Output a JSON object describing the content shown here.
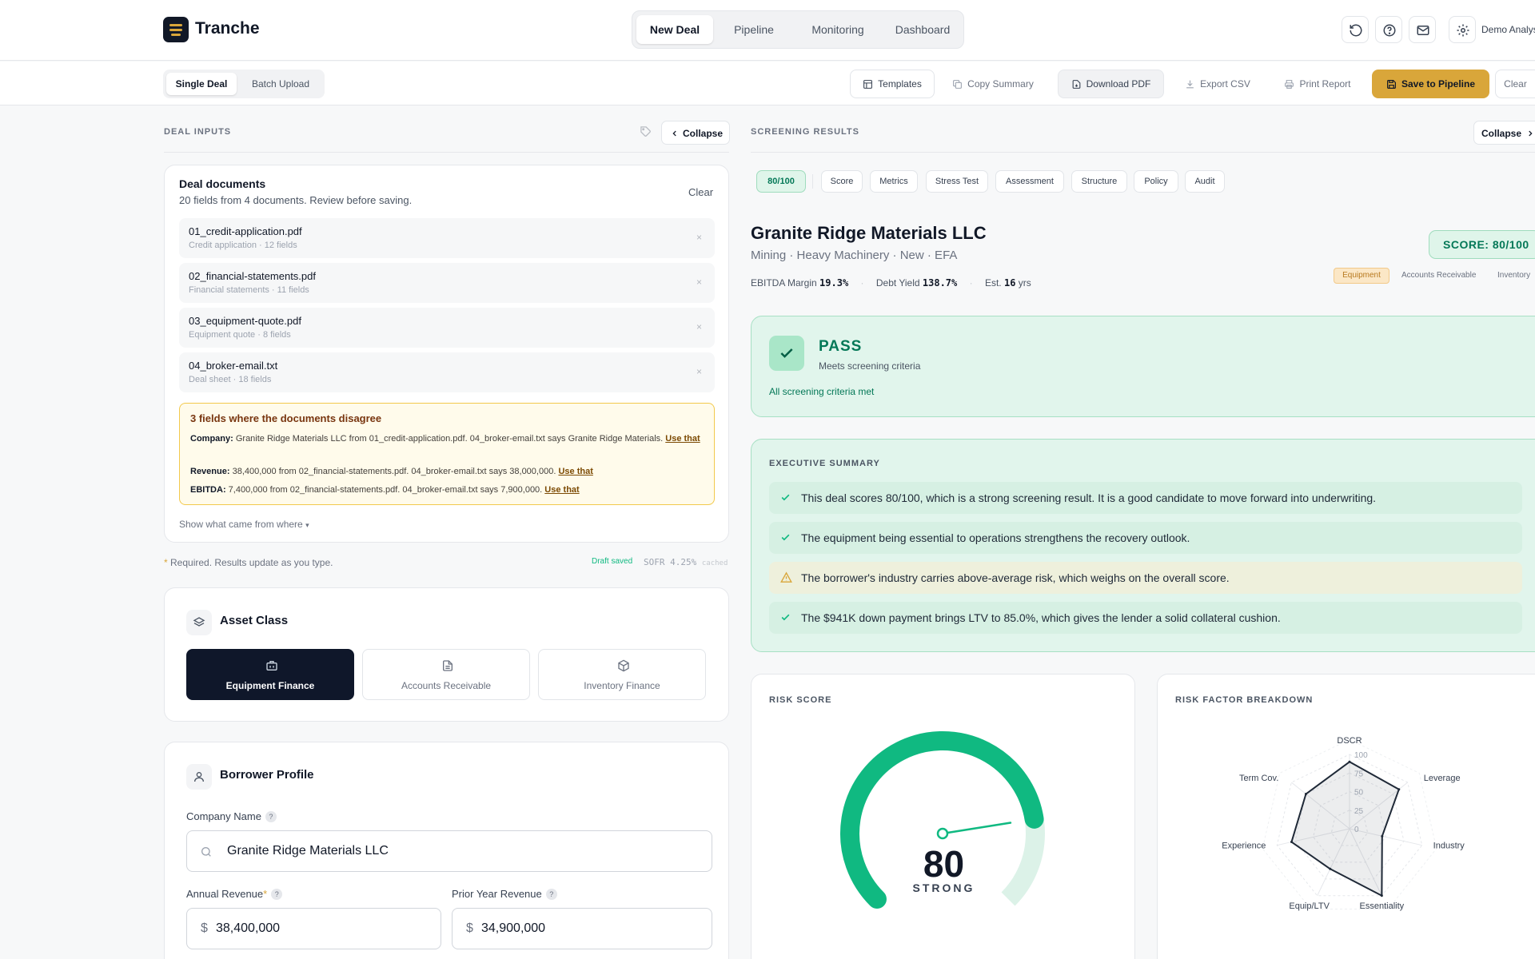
{
  "app": {
    "name": "Tranche"
  },
  "nav": {
    "tabs": [
      "New Deal",
      "Pipeline",
      "Monitoring",
      "Dashboard"
    ],
    "active": "New Deal"
  },
  "header": {
    "user_label": "Demo Analyst"
  },
  "toolbar": {
    "modes": [
      "Single Deal",
      "Batch Upload"
    ],
    "templates": "Templates",
    "copy_summary": "Copy Summary",
    "download_pdf": "Download PDF",
    "export_csv": "Export CSV",
    "print_report": "Print Report",
    "save_pipeline": "Save to Pipeline",
    "clear": "Clear"
  },
  "left": {
    "section_title": "DEAL INPUTS",
    "collapse": "Collapse",
    "docs": {
      "title": "Deal documents",
      "subtitle": "20 fields from 4 documents. Review before saving.",
      "clear": "Clear",
      "files": [
        {
          "name": "01_credit-application.pdf",
          "meta": "Credit application · 12 fields"
        },
        {
          "name": "02_financial-statements.pdf",
          "meta": "Financial statements · 11 fields"
        },
        {
          "name": "03_equipment-quote.pdf",
          "meta": "Equipment quote · 8 fields"
        },
        {
          "name": "04_broker-email.txt",
          "meta": "Deal sheet · 18 fields"
        }
      ],
      "remove_glyph": "×",
      "conflicts_title": "3 fields where the documents disagree",
      "conflicts": [
        {
          "label": "Company:",
          "text": "Granite Ridge Materials LLC from 01_credit-application.pdf. 04_broker-email.txt says Granite Ridge Materials.",
          "action": "Use that"
        },
        {
          "label": "Revenue:",
          "text": "38,400,000 from 02_financial-statements.pdf. 04_broker-email.txt says 38,000,000.",
          "action": "Use that"
        },
        {
          "label": "EBITDA:",
          "text": "7,400,000 from 02_financial-statements.pdf. 04_broker-email.txt says 7,900,000.",
          "action": "Use that"
        }
      ],
      "show_sources": "Show what came from where",
      "show_sources_caret": "▾"
    },
    "required_star": "*",
    "required_note": "Required. Results update as you type.",
    "draft_saved": "Draft saved",
    "sofr_label": "SOFR",
    "sofr_value": "4.25%",
    "sofr_cached": "cached",
    "asset_class": {
      "title": "Asset Class",
      "options": [
        "Equipment Finance",
        "Accounts Receivable",
        "Inventory Finance"
      ],
      "selected": 0
    },
    "borrower": {
      "title": "Borrower Profile",
      "company_label": "Company Name",
      "company_value": "Granite Ridge Materials LLC",
      "revenue_label": "Annual Revenue",
      "revenue_value": "38,400,000",
      "prior_label": "Prior Year Revenue",
      "prior_value": "34,900,000",
      "currency": "$",
      "help": "?"
    }
  },
  "right": {
    "section_title": "SCREENING RESULTS",
    "collapse": "Collapse",
    "pills": [
      "80/100",
      "Score",
      "Metrics",
      "Stress Test",
      "Assessment",
      "Structure",
      "Policy",
      "Audit"
    ],
    "company": "Granite Ridge Materials LLC",
    "company_meta": "Mining · Heavy Machinery · New · EFA",
    "score_badge": "SCORE: 80/100",
    "asset_tags": [
      "Equipment",
      "Accounts Receivable",
      "Inventory"
    ],
    "metrics": [
      {
        "label": "EBITDA Margin",
        "value": "19.3%"
      },
      {
        "label": "Debt Yield",
        "value": "138.7%"
      },
      {
        "label": "Est.",
        "value": "16",
        "suffix": "yrs"
      }
    ],
    "verdict": {
      "title": "PASS",
      "subtitle": "Meets screening criteria",
      "note": "All screening criteria met"
    },
    "exec_summary": {
      "title": "EXECUTIVE SUMMARY",
      "items": [
        {
          "type": "check",
          "text": "This deal scores 80/100, which is a strong screening result. It is a good candidate to move forward into underwriting."
        },
        {
          "type": "check",
          "text": "The equipment being essential to operations strengthens the recovery outlook."
        },
        {
          "type": "warning",
          "text": "The borrower's industry carries above-average risk, which weighs on the overall score."
        },
        {
          "type": "check",
          "text": "The $941K down payment brings LTV to 85.0%, which gives the lender a solid collateral cushion."
        }
      ]
    },
    "risk_score": {
      "title": "RISK SCORE",
      "value": "80",
      "score": 80,
      "max": 100,
      "label": "STRONG"
    },
    "colors": {
      "accent": "#10b981",
      "gold": "#d9a63a",
      "dark": "#0f172a",
      "pass_bg": "#e1f5ec"
    }
  },
  "chart_data": {
    "type": "radar",
    "title": "RISK FACTOR BREAKDOWN",
    "categories": [
      "DSCR",
      "Leverage",
      "Industry",
      "Essentiality",
      "Equip/LTV",
      "Experience",
      "Term Cov."
    ],
    "values": [
      90,
      85,
      45,
      100,
      60,
      80,
      75
    ],
    "radial_ticks": [
      "0",
      "25",
      "50",
      "75",
      "100"
    ],
    "range": [
      0,
      100
    ]
  }
}
